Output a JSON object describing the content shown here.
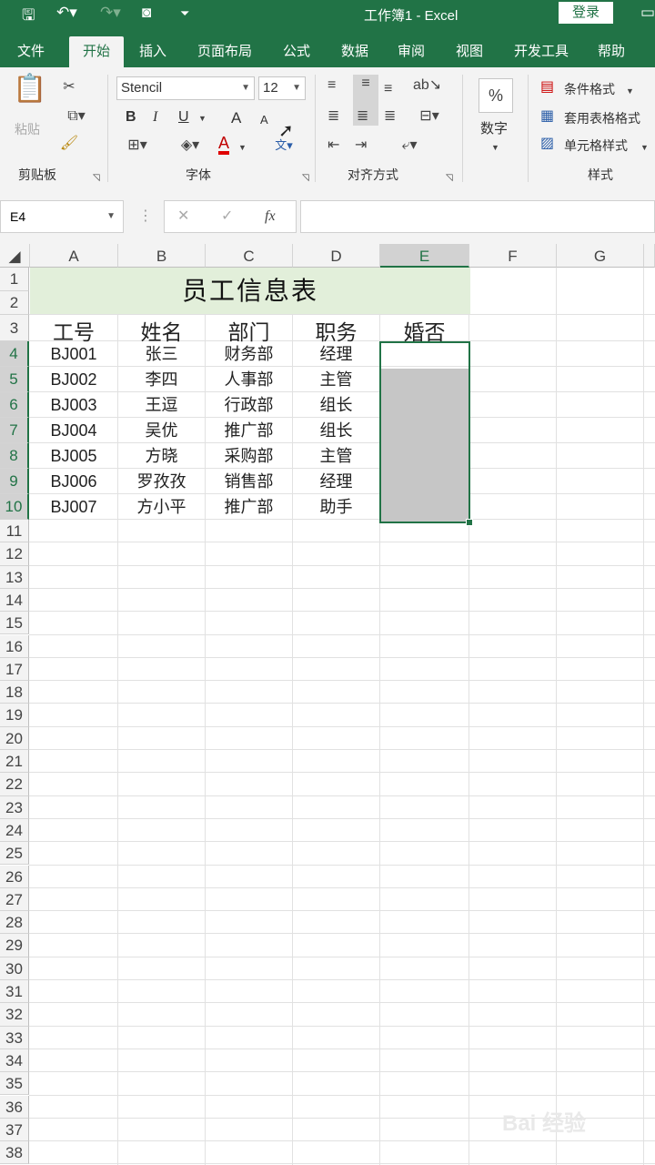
{
  "window": {
    "title": "工作簿1  -  Excel",
    "login": "登录"
  },
  "tabs": [
    "文件",
    "开始",
    "插入",
    "页面布局",
    "公式",
    "数据",
    "审阅",
    "视图",
    "开发工具",
    "帮助"
  ],
  "ribbon": {
    "clipboard": {
      "paste": "粘贴",
      "label": "剪贴板"
    },
    "font": {
      "name": "Stencil",
      "size": "12",
      "bold": "B",
      "italic": "I",
      "underline": "U",
      "grow": "A",
      "shrink": "A",
      "color": "A",
      "label": "字体"
    },
    "alignment": {
      "label": "对齐方式"
    },
    "number": {
      "symbol": "%",
      "text": "数字"
    },
    "styles": {
      "conditional": "条件格式",
      "table": "套用表格格式",
      "cell": "单元格样式",
      "label": "样式"
    }
  },
  "formula_bar": {
    "name_box": "E4",
    "fx": "fx",
    "formula": ""
  },
  "columns": [
    "A",
    "B",
    "C",
    "D",
    "E",
    "F",
    "G"
  ],
  "rows": [
    "1",
    "2",
    "3",
    "4",
    "5",
    "6",
    "7",
    "8",
    "9",
    "10",
    "11",
    "12",
    "13",
    "14",
    "15",
    "16",
    "17",
    "18",
    "19",
    "20",
    "21",
    "22",
    "23",
    "24",
    "25",
    "26",
    "27",
    "28",
    "29",
    "30",
    "31",
    "32",
    "33",
    "34",
    "35",
    "36",
    "37",
    "38"
  ],
  "sheet": {
    "title": "员工信息表",
    "headers": [
      "工号",
      "姓名",
      "部门",
      "职务",
      "婚否"
    ],
    "data": [
      [
        "BJ001",
        "张三",
        "财务部",
        "经理",
        ""
      ],
      [
        "BJ002",
        "李四",
        "人事部",
        "主管",
        ""
      ],
      [
        "BJ003",
        "王逗",
        "行政部",
        "组长",
        ""
      ],
      [
        "BJ004",
        "吴优",
        "推广部",
        "组长",
        ""
      ],
      [
        "BJ005",
        "方晓",
        "采购部",
        "主管",
        ""
      ],
      [
        "BJ006",
        "罗孜孜",
        "销售部",
        "经理",
        ""
      ],
      [
        "BJ007",
        "方小平",
        "推广部",
        "助手",
        ""
      ]
    ]
  },
  "watermark": "Bai 经验"
}
